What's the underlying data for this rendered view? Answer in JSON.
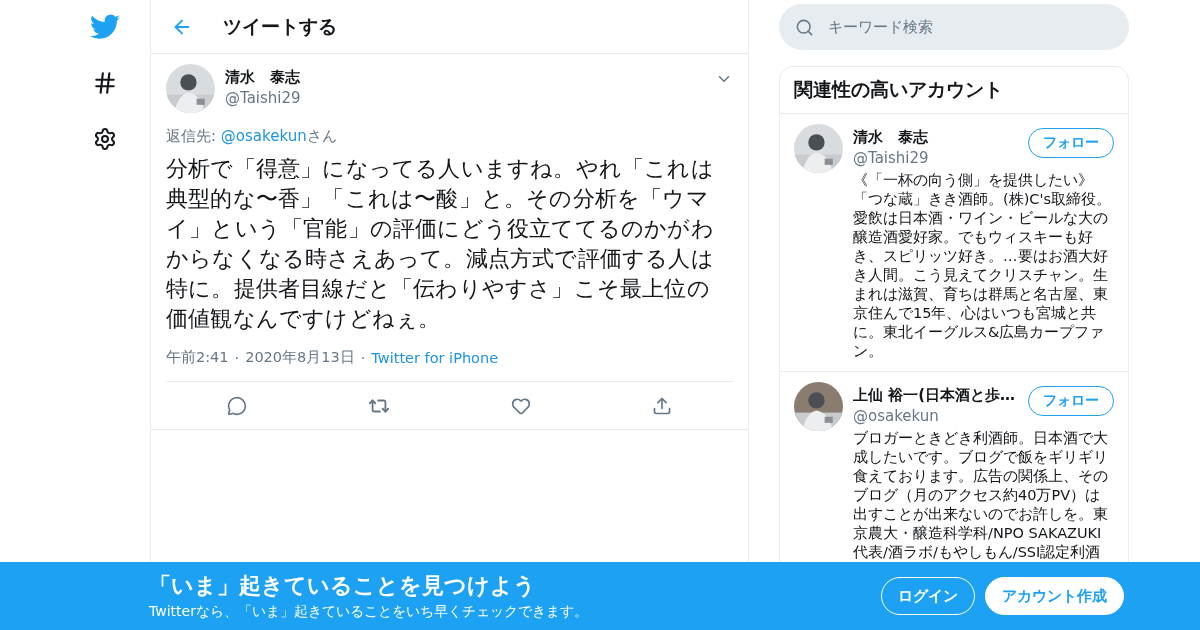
{
  "header": {
    "title": "ツイートする"
  },
  "tweet": {
    "name": "清水　泰志",
    "handle": "@Taishi29",
    "reply_to": {
      "label": "返信先:",
      "handle": "@osakekun",
      "suffix": "さん"
    },
    "text": "分析で「得意」になってる人いますね。やれ「これは典型的な〜香」「これは〜酸」と。その分析を「ウマイ」という「官能」の評価にどう役立ててるのかがわからなくなる時さえあって。減点方式で評価する人は特に。提供者目線だと「伝わりやすさ」こそ最上位の価値観なんですけどねぇ。",
    "time": "午前2:41",
    "separator": "·",
    "date": "2020年8月13日",
    "source": "Twitter for iPhone"
  },
  "search": {
    "placeholder": "キーワード検索"
  },
  "related": {
    "title": "関連性の高いアカウント",
    "accounts": [
      {
        "name": "清水　泰志",
        "handle": "@Taishi29",
        "follow": "フォロー",
        "bio": "《「一杯の向う側」を提供したい》「つな蔵」きき酒師。(株)C's取締役。愛飲は日本酒・ワイン・ビールな大の醸造酒愛好家。でもウィスキーも好き、スピリッツ好き。…要はお酒大好き人間。こう見えてクリスチャン。生まれは滋賀、育ちは群馬と名古屋、東京住んで15年、心はいつも宮城と共に。東北イーグルス&広島カープファン。"
      },
      {
        "name": "上仙 裕一(日本酒と歩…",
        "handle": "@osakekun",
        "follow": "フォロー",
        "bio": "ブロガーときどき利酒師。日本酒で大成したいです。ブログで飯をギリギリ食えております。広告の関係上、そのブログ（月のアクセス約40万PV）は出すことが出来ないのでお許しを。東京農大・醸造科学科/NPO SAKAZUKI代表/酒ラボ/もやしもん/SSI認定利酒"
      }
    ]
  },
  "banner": {
    "title": "「いま」起きていることを見つけよう",
    "subtitle": "Twitterなら、「いま」起きていることをいち早くチェックできます。",
    "login": "ログイン",
    "signup": "アカウント作成"
  }
}
